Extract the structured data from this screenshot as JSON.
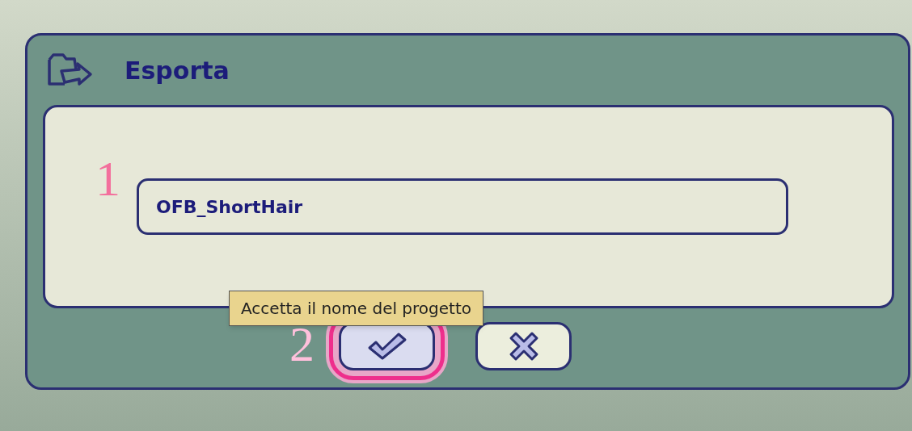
{
  "dialog": {
    "title": "Esporta"
  },
  "name_field": {
    "value": "OFB_ShortHair"
  },
  "buttons": [
    {
      "kind": "accept",
      "hovered": true,
      "highlighted": true
    },
    {
      "kind": "cancel",
      "hovered": false,
      "highlighted": false
    }
  ],
  "tooltip": "Accetta il nome del progetto",
  "annotations": [
    "1",
    "2"
  ]
}
